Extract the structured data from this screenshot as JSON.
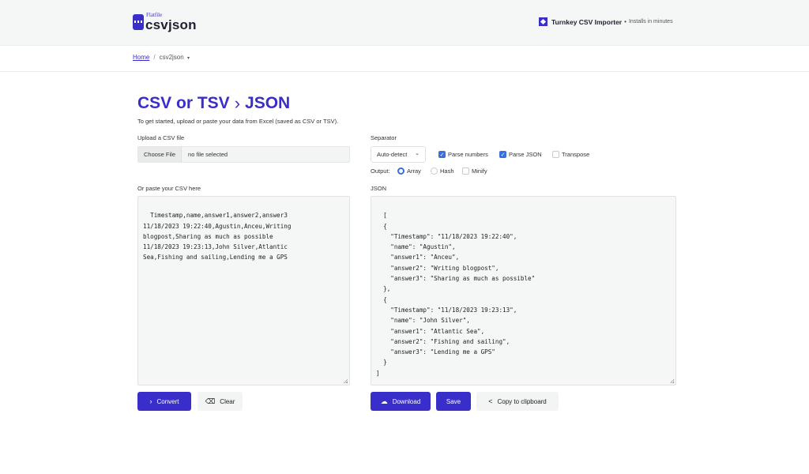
{
  "header": {
    "logo_small": "Flatfile",
    "logo_big": "csvjson",
    "promo_title": "Turnkey CSV Importer",
    "promo_separator": "•",
    "promo_subtitle": "Installs in minutes"
  },
  "breadcrumb": {
    "home": "Home",
    "separator": "/",
    "current": "csv2json",
    "caret": "▾"
  },
  "page": {
    "title_left": "CSV or TSV",
    "title_chevron": "›",
    "title_right": "JSON",
    "subtitle": "To get started, upload or paste your data from Excel (saved as CSV or TSV)."
  },
  "upload": {
    "label": "Upload a CSV file",
    "button": "Choose File",
    "filename": "no file selected"
  },
  "options": {
    "separator_label": "Separator",
    "separator_value": "Auto-detect",
    "parse_numbers": {
      "label": "Parse numbers",
      "checked": true
    },
    "parse_json": {
      "label": "Parse JSON",
      "checked": true
    },
    "transpose": {
      "label": "Transpose",
      "checked": false
    },
    "output_label": "Output:",
    "output_array": {
      "label": "Array",
      "selected": true
    },
    "output_hash": {
      "label": "Hash",
      "selected": false
    },
    "minify": {
      "label": "Minify",
      "checked": false
    }
  },
  "csv": {
    "label": "Or paste your CSV here",
    "value": "Timestamp,name,answer1,answer2,answer3\n11/18/2023 19:22:40,Agustin,Anceu,Writing\nblogpost,Sharing as much as possible\n11/18/2023 19:23:13,John Silver,Atlantic\nSea,Fishing and sailing,Lending me a GPS"
  },
  "json": {
    "label": "JSON",
    "value": "[\n  {\n    \"Timestamp\": \"11/18/2023 19:22:40\",\n    \"name\": \"Agustin\",\n    \"answer1\": \"Anceu\",\n    \"answer2\": \"Writing blogpost\",\n    \"answer3\": \"Sharing as much as possible\"\n  },\n  {\n    \"Timestamp\": \"11/18/2023 19:23:13\",\n    \"name\": \"John Silver\",\n    \"answer1\": \"Atlantic Sea\",\n    \"answer2\": \"Fishing and sailing\",\n    \"answer3\": \"Lending me a GPS\"\n  }\n]"
  },
  "buttons": {
    "convert": "Convert",
    "clear": "Clear",
    "download": "Download",
    "save": "Save",
    "copy": "Copy to clipboard"
  },
  "colors": {
    "brand": "#3a2ecb",
    "checkbox": "#3a6fe0"
  }
}
